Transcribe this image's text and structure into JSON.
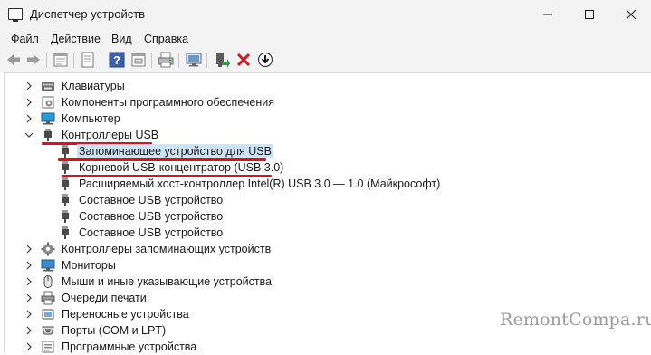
{
  "window": {
    "title": "Диспетчер устройств"
  },
  "menu": [
    "Файл",
    "Действие",
    "Вид",
    "Справка"
  ],
  "toolbar": {
    "icons": [
      "back-arrow-icon",
      "forward-arrow-icon",
      "properties-icon",
      "refresh-list-icon",
      "help-icon",
      "view-tree-icon",
      "print-icon",
      "monitor-icon",
      "enable-device-icon",
      "uninstall-device-icon",
      "update-driver-icon"
    ]
  },
  "tree": {
    "items": [
      {
        "label": "Клавиатуры",
        "icon": "keyboard-icon",
        "level": 1,
        "state": "collapsed"
      },
      {
        "label": "Компоненты программного обеспечения",
        "icon": "software-component-icon",
        "level": 1,
        "state": "collapsed"
      },
      {
        "label": "Компьютер",
        "icon": "computer-icon",
        "level": 1,
        "state": "collapsed"
      },
      {
        "label": "Контроллеры USB",
        "icon": "usb-connector-icon",
        "level": 1,
        "state": "expanded",
        "highlighted": true
      },
      {
        "label": "Запоминающее устройство для USB",
        "icon": "usb-connector-icon",
        "level": 2,
        "selected": true,
        "highlighted": true
      },
      {
        "label": "Корневой USB-концентратор (USB 3.0)",
        "icon": "usb-connector-icon",
        "level": 2,
        "highlighted": true
      },
      {
        "label": "Расширяемый хост-контроллер Intel(R) USB 3.0 — 1.0 (Майкрософт)",
        "icon": "usb-connector-icon",
        "level": 2
      },
      {
        "label": "Составное USB устройство",
        "icon": "usb-connector-icon",
        "level": 2
      },
      {
        "label": "Составное USB устройство",
        "icon": "usb-connector-icon",
        "level": 2
      },
      {
        "label": "Составное USB устройство",
        "icon": "usb-connector-icon",
        "level": 2
      },
      {
        "label": "Контроллеры запоминающих устройств",
        "icon": "storage-controller-icon",
        "level": 1,
        "state": "collapsed"
      },
      {
        "label": "Мониторы",
        "icon": "monitor-icon",
        "level": 1,
        "state": "collapsed"
      },
      {
        "label": "Мыши и иные указывающие устройства",
        "icon": "mouse-icon",
        "level": 1,
        "state": "collapsed"
      },
      {
        "label": "Очереди печати",
        "icon": "printer-icon",
        "level": 1,
        "state": "collapsed"
      },
      {
        "label": "Переносные устройства",
        "icon": "portable-device-icon",
        "level": 1,
        "state": "collapsed"
      },
      {
        "label": "Порты (COM и LPT)",
        "icon": "port-icon",
        "level": 1,
        "state": "collapsed"
      },
      {
        "label": "Программные устройства",
        "icon": "software-device-icon",
        "level": 1,
        "state": "collapsed"
      }
    ]
  },
  "colors": {
    "selection": "#cce4f7",
    "annotation": "#e0101a"
  },
  "watermark": "RemontCompa.ru"
}
